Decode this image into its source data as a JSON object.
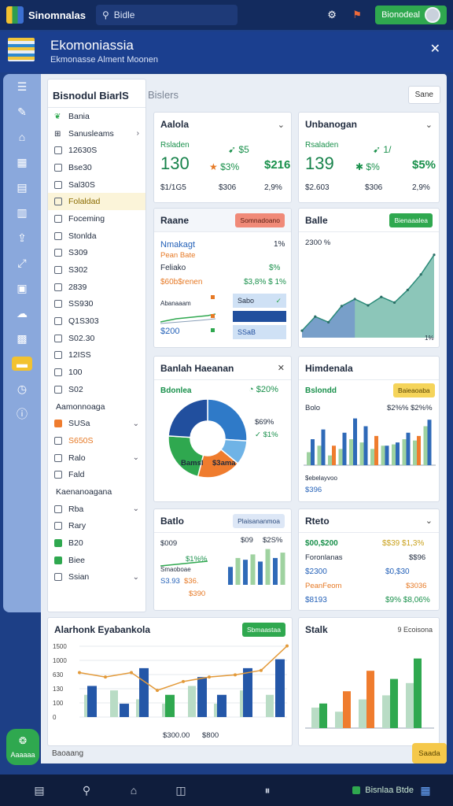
{
  "topbar": {
    "app_title": "Sinomnalas",
    "search_text": "Bidle",
    "cta_label": "Bionodeal"
  },
  "header": {
    "title": "Ekomoniassia",
    "subtitle": "Ekmonasse Alment Moonen"
  },
  "rail": {
    "icons": [
      "list-icon",
      "chat-icon",
      "tag-icon",
      "grid-icon",
      "table-icon",
      "bars-icon",
      "upload-icon",
      "share-icon",
      "image-icon",
      "cloud-icon",
      "layout-icon",
      "folder-icon",
      "history-icon",
      "info-icon"
    ]
  },
  "filters": {
    "title": "Bisnodul BiarlS",
    "items": [
      {
        "label": "Bania",
        "box": "leaf"
      },
      {
        "label": "Sanusleams",
        "box": "grid",
        "arrow": "›"
      },
      {
        "label": "12630S",
        "box": "check"
      },
      {
        "label": "Bse30",
        "box": "check"
      },
      {
        "label": "Sal30S",
        "box": "check"
      },
      {
        "label": "Folaldad",
        "box": "check",
        "hl": true
      },
      {
        "label": "Foceming",
        "box": "check"
      },
      {
        "label": "Stonlda",
        "box": "check"
      },
      {
        "label": "S309",
        "box": "check"
      },
      {
        "label": "S302",
        "box": "check"
      },
      {
        "label": "2839",
        "box": "check"
      },
      {
        "label": "SS930",
        "box": "check"
      },
      {
        "label": "Q1S303",
        "box": "check"
      },
      {
        "label": "S02.30",
        "box": "check"
      },
      {
        "label": "12ISS",
        "box": "check"
      },
      {
        "label": "100",
        "box": "check"
      },
      {
        "label": "S02",
        "box": "check"
      },
      {
        "label": "Aamonnoaga",
        "section": true
      },
      {
        "label": "SUSa",
        "box": "orange",
        "arrow": "⌄"
      },
      {
        "label": "S650S",
        "box": "check",
        "color": "org"
      },
      {
        "label": "Ralo",
        "box": "check",
        "arrow": "⌄"
      },
      {
        "label": "Fald",
        "box": "check"
      },
      {
        "label": "Kaenanoagana",
        "section": true
      },
      {
        "label": "Rba",
        "box": "check",
        "arrow": "⌄"
      },
      {
        "label": "Rary",
        "box": "check"
      },
      {
        "label": "B20",
        "box": "green"
      },
      {
        "label": "Biee",
        "box": "green"
      },
      {
        "label": "Ssian",
        "box": "check",
        "arrow": "⌄"
      }
    ]
  },
  "tabs_top": {
    "tab": "Bislers",
    "button": "Sane"
  },
  "kpi1": {
    "title": "Aalola",
    "sub": "Rsladen",
    "big": "130",
    "v1": "$5",
    "v2": "$3%",
    "v3": "$216",
    "a": "$1/1G5",
    "b": "$306",
    "c": "2,9%"
  },
  "kpi2": {
    "title": "Unbanogan",
    "sub": "Rsaladen",
    "big": "139",
    "v1": "1/",
    "v2": "$%",
    "v3": "$5%",
    "a": "$2.603",
    "b": "$306",
    "c": "2,9%"
  },
  "card3": {
    "title": "Raane",
    "tag": "Somnadoano",
    "l1": "Nmakagt",
    "l1v": "1%",
    "l1b": "Pean Bate",
    "l2": "Feliako",
    "l2v": "$%",
    "l3": "$60b$renen",
    "l3v": "$3,8%  $ 1%",
    "small": "Abanaaam",
    "k1": "$200",
    "box1": "Sabo",
    "box2": "",
    "box3": "SSaB"
  },
  "card4": {
    "title": "Balle",
    "tag": "Bienaaalea",
    "axis": "2300 %",
    "corner": "1%"
  },
  "card5": {
    "title": "Banlah Haeanan",
    "sub": "Bdonlea",
    "pct": "$20%",
    "l1": "$69%",
    "l2": "$1%",
    "center": "Bamsl",
    "center2": "$3ama"
  },
  "card6": {
    "title": "Himdenala",
    "sub": "Bslondd",
    "tag": "Baieaoaba",
    "axis1": "Bolo",
    "axis2": "$2%%  $2%%",
    "leg": "$ebelayvoo",
    "k": "$396"
  },
  "card7": {
    "title": "Batlo",
    "tag": "Plaisananmoa",
    "a": "$009",
    "b": "$09",
    "c": "$2S%",
    "d": "Smaoboae",
    "e": "$1%%",
    "f": "S3.93",
    "g": "$36.",
    "h": "$390"
  },
  "card8": {
    "title": "Rteto",
    "r1a": "$00,$200",
    "r1b": "$$39 $1,3%",
    "r2a": "Foronlanas",
    "r2b": "$$96",
    "r3a": "$2300",
    "r3b": "$0,$30",
    "r4a": "PeanFeom",
    "r4b": "$3036",
    "r5a": "$8193",
    "r5b": "$9%  $8,06%"
  },
  "card9": {
    "title": "Alarhonk Eyabankola",
    "tag": "Sbmaastaa",
    "foot1": "$300.00",
    "foot2": "$800",
    "yticks": [
      "1500",
      "1000",
      "630",
      "130",
      "100",
      "0"
    ]
  },
  "card10": {
    "title": "Stalk",
    "tag": "9  Ecoisona"
  },
  "footer_note": "Baoaang",
  "fab": {
    "label": "Aaaaaa"
  },
  "help": {
    "label": "Saada"
  },
  "bottom": {
    "status": "Bisnlaa Btde"
  },
  "chart_data": [
    {
      "type": "area",
      "title": "Balle",
      "values": [
        10,
        30,
        22,
        45,
        55,
        46,
        58,
        50,
        68,
        90,
        118
      ],
      "ylabel": "2300 %"
    },
    {
      "type": "pie",
      "title": "Banlah Haeanan",
      "series": [
        {
          "values": [
            26,
            10,
            18,
            22,
            24
          ]
        }
      ],
      "colors": [
        "#2f7ac8",
        "#6fb3e6",
        "#ef7c2e",
        "#2fa84f",
        "#214f9e"
      ]
    },
    {
      "type": "bar",
      "title": "Himdenala",
      "series": [
        {
          "values": [
            40,
            55,
            30,
            50,
            72,
            60,
            45,
            30,
            35,
            50,
            45,
            70
          ]
        },
        {
          "values": [
            20,
            30,
            15,
            25,
            40,
            35,
            25,
            30,
            32,
            40,
            38,
            60
          ]
        }
      ]
    },
    {
      "type": "bar",
      "title": "Alarhonk Eyabankola",
      "series": [
        {
          "values": [
            700,
            300,
            1100,
            500,
            900,
            500,
            1100,
            1300
          ]
        },
        {
          "values": [
            500,
            600,
            400,
            300,
            700,
            300,
            600,
            500
          ]
        }
      ],
      "line": [
        1000,
        900,
        1000,
        600,
        800,
        900,
        950,
        1050,
        1600
      ]
    },
    {
      "type": "bar",
      "title": "Stalk",
      "series": [
        {
          "values": [
            30,
            45,
            70,
            60,
            85
          ]
        },
        {
          "values": [
            25,
            20,
            35,
            40,
            55
          ]
        }
      ]
    }
  ]
}
